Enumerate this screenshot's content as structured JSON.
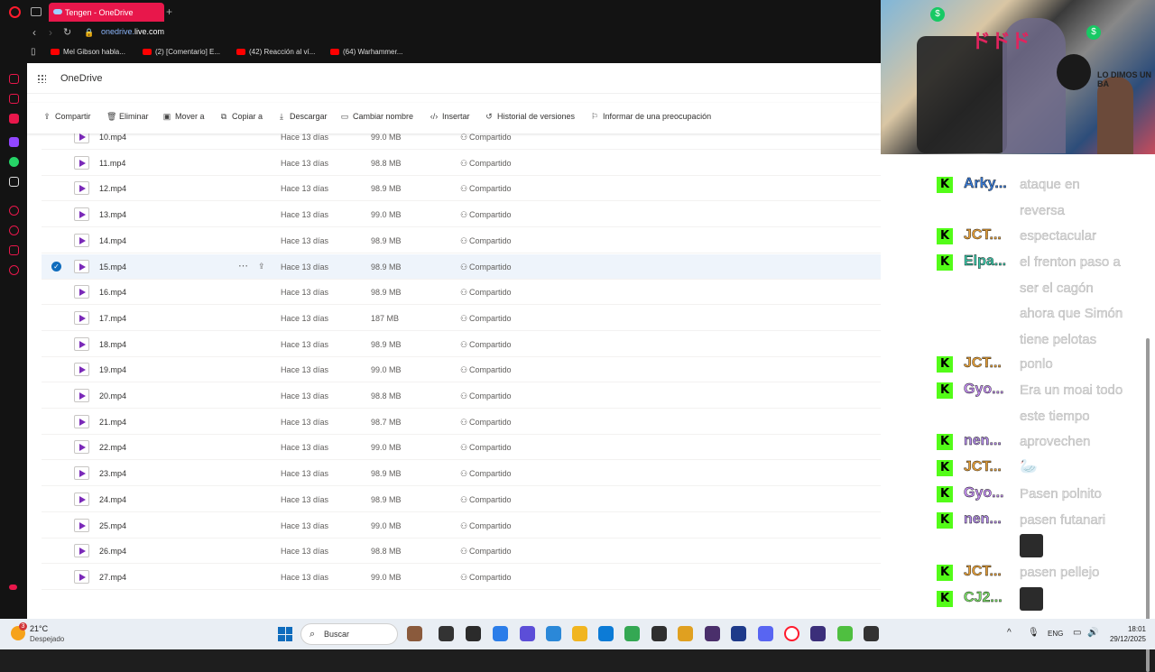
{
  "browser": {
    "tab_title": "Tengen - OneDrive",
    "new_tab": "+",
    "url_prefix": "onedrive.",
    "url_domain": "live.com",
    "bookmarks": [
      "Mel Gibson habla...",
      "(2) [Comentario] E...",
      "(42) Reacción al ví...",
      "(64) Warhammer..."
    ]
  },
  "onedrive": {
    "app_name": "OneDrive",
    "commands": [
      {
        "icon": "share-icon",
        "label": "Compartir"
      },
      {
        "icon": "delete-icon",
        "label": "Eliminar"
      },
      {
        "icon": "move-icon",
        "label": "Mover a"
      },
      {
        "icon": "copy-icon",
        "label": "Copiar a"
      },
      {
        "icon": "download-icon",
        "label": "Descargar"
      },
      {
        "icon": "rename-icon",
        "label": "Cambiar nombre"
      },
      {
        "icon": "embed-icon",
        "label": "Insertar"
      },
      {
        "icon": "history-icon",
        "label": "Historial de versiones"
      },
      {
        "icon": "report-icon",
        "label": "Informar de una preocupación"
      }
    ],
    "files": [
      {
        "name": "10.mp4",
        "modified": "Hace 13 días",
        "size": "99.0 MB",
        "sharing": "Compartido"
      },
      {
        "name": "11.mp4",
        "modified": "Hace 13 días",
        "size": "98.8 MB",
        "sharing": "Compartido"
      },
      {
        "name": "12.mp4",
        "modified": "Hace 13 días",
        "size": "98.9 MB",
        "sharing": "Compartido"
      },
      {
        "name": "13.mp4",
        "modified": "Hace 13 días",
        "size": "99.0 MB",
        "sharing": "Compartido"
      },
      {
        "name": "14.mp4",
        "modified": "Hace 13 días",
        "size": "98.9 MB",
        "sharing": "Compartido"
      },
      {
        "name": "15.mp4",
        "modified": "Hace 13 días",
        "size": "98.9 MB",
        "sharing": "Compartido",
        "selected": true
      },
      {
        "name": "16.mp4",
        "modified": "Hace 13 días",
        "size": "98.9 MB",
        "sharing": "Compartido"
      },
      {
        "name": "17.mp4",
        "modified": "Hace 13 días",
        "size": "187 MB",
        "sharing": "Compartido"
      },
      {
        "name": "18.mp4",
        "modified": "Hace 13 días",
        "size": "98.9 MB",
        "sharing": "Compartido"
      },
      {
        "name": "19.mp4",
        "modified": "Hace 13 días",
        "size": "99.0 MB",
        "sharing": "Compartido"
      },
      {
        "name": "20.mp4",
        "modified": "Hace 13 días",
        "size": "98.8 MB",
        "sharing": "Compartido"
      },
      {
        "name": "21.mp4",
        "modified": "Hace 13 días",
        "size": "98.7 MB",
        "sharing": "Compartido"
      },
      {
        "name": "22.mp4",
        "modified": "Hace 13 días",
        "size": "99.0 MB",
        "sharing": "Compartido"
      },
      {
        "name": "23.mp4",
        "modified": "Hace 13 días",
        "size": "98.9 MB",
        "sharing": "Compartido"
      },
      {
        "name": "24.mp4",
        "modified": "Hace 13 días",
        "size": "98.9 MB",
        "sharing": "Compartido"
      },
      {
        "name": "25.mp4",
        "modified": "Hace 13 días",
        "size": "99.0 MB",
        "sharing": "Compartido"
      },
      {
        "name": "26.mp4",
        "modified": "Hace 13 días",
        "size": "98.8 MB",
        "sharing": "Compartido"
      },
      {
        "name": "27.mp4",
        "modified": "Hace 13 días",
        "size": "99.0 MB",
        "sharing": "Compartido"
      }
    ]
  },
  "stream_overlay": {
    "webcam_sign": "LO DIMOS UN BA",
    "webcam_kana": "ドドド",
    "coin_symbol": "$",
    "chat": [
      {
        "user": "Arky...",
        "color": "#3b7dd8",
        "lines": [
          "ataque en",
          "reversa"
        ]
      },
      {
        "user": "JCT...",
        "color": "#e8a23b",
        "lines": [
          "espectacular"
        ]
      },
      {
        "user": "Elpa...",
        "color": "#3cc7a8",
        "lines": [
          "el frenton paso a",
          "ser el cagón",
          "ahora que Simón",
          "tiene pelotas"
        ]
      },
      {
        "user": "JCT...",
        "color": "#e8a23b",
        "lines": [
          "ponlo"
        ]
      },
      {
        "user": "Gyo...",
        "color": "#c38ef0",
        "lines": [
          "Era un moai todo",
          "este tiempo",
          "aprovechen"
        ]
      },
      {
        "user": "nen...",
        "color": "#b48de8",
        "lines": []
      },
      {
        "user": "JCT...",
        "color": "#e8a23b",
        "lines": []
      },
      {
        "user": "Gyo...",
        "color": "#c38ef0",
        "lines": [
          "Pasen polnito"
        ]
      },
      {
        "user": "nen...",
        "color": "#b48de8",
        "lines": [
          "pasen futanari"
        ]
      },
      {
        "user": "JCT...",
        "color": "#e8a23b",
        "lines": [
          "pasen pellejo"
        ]
      },
      {
        "user": "CJ2...",
        "color": "#7ee06a",
        "lines": []
      }
    ]
  },
  "taskbar": {
    "temperature": "21°C",
    "weather": "Despejado",
    "weather_badge": "3",
    "search_placeholder": "Buscar",
    "language": "ENG",
    "time": "18:01",
    "date": "29/12/2025",
    "app_colors": [
      "#8a5a3c",
      "#333333",
      "#2b2b2b",
      "#2b7de9",
      "#5c4ed8",
      "#2b88d8",
      "#f1b520",
      "#0c7bd6",
      "#34a853",
      "#2f2f2f",
      "#e0a020",
      "#4a2f6b",
      "#1e3a8a",
      "#5865f2",
      "#ff1b2d",
      "#3b2f7a",
      "#4fbf40",
      "#333333",
      "#1e2f5a"
    ]
  }
}
